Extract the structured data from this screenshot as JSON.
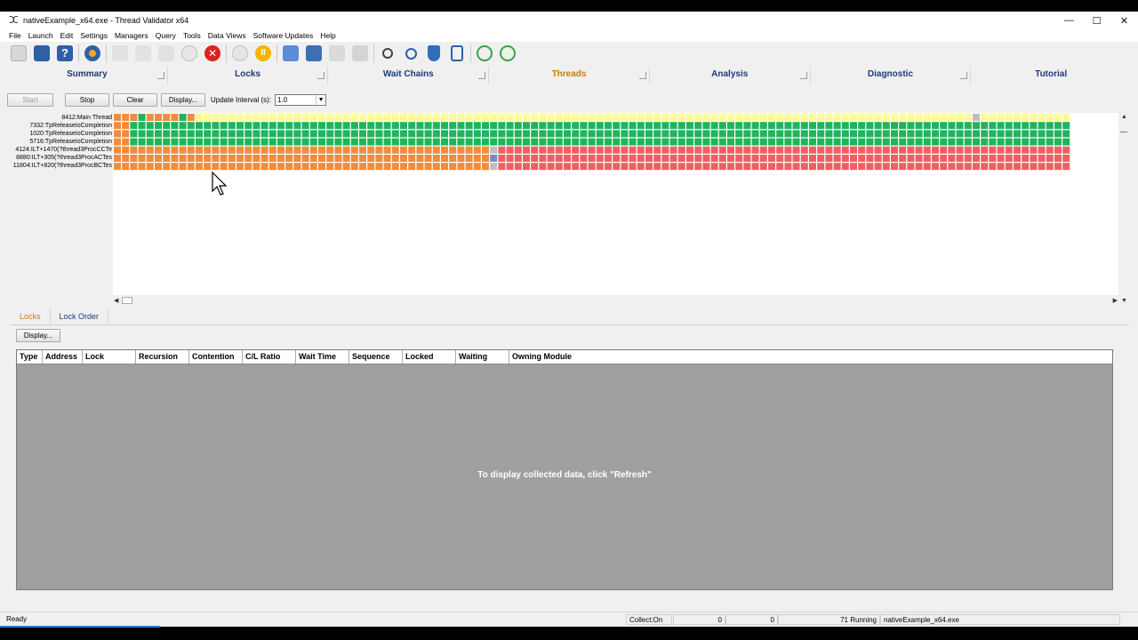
{
  "window": {
    "title": "nativeExample_x64.exe - Thread Validator x64",
    "controls": [
      "—",
      "☐",
      "✕"
    ]
  },
  "menu": [
    "File",
    "Launch",
    "Edit",
    "Settings",
    "Managers",
    "Query",
    "Tools",
    "Data Views",
    "Software Updates",
    "Help"
  ],
  "toolbar": {
    "icons": [
      "open-icon",
      "save-icon",
      "help-icon",
      "settings-gear-icon",
      "launch-icon",
      "inject-icon",
      "monitor-icon",
      "timer-icon",
      "stop-icon",
      "play-icon",
      "pause-icon",
      "add-folder-icon",
      "bookmark-icon",
      "group-icon",
      "factory-icon",
      "find-icon",
      "find-object-icon",
      "shield-icon",
      "book-icon",
      "refresh-icon",
      "auto-refresh-icon"
    ]
  },
  "tabs": [
    {
      "label": "Summary",
      "active": false
    },
    {
      "label": "Locks",
      "active": false
    },
    {
      "label": "Wait Chains",
      "active": false
    },
    {
      "label": "Threads",
      "active": true
    },
    {
      "label": "Analysis",
      "active": false
    },
    {
      "label": "Diagnostic",
      "active": false
    },
    {
      "label": "Tutorial",
      "active": false
    }
  ],
  "controls": {
    "start": "Start",
    "stop": "Stop",
    "clear": "Clear",
    "display": "Display...",
    "interval_label": "Update Interval (s):",
    "interval_value": "1.0"
  },
  "threads": [
    {
      "name": "8412:Main Thread",
      "pattern": "main"
    },
    {
      "name": "7332:TpReleaseIoCompletion",
      "pattern": "green"
    },
    {
      "name": "1020:TpReleaseIoCompletion",
      "pattern": "green"
    },
    {
      "name": "5716:TpReleaseIoCompletion",
      "pattern": "green"
    },
    {
      "name": "4124:ILT+1470(?thread3ProcCCTe",
      "pattern": "orange-red"
    },
    {
      "name": "8880:ILT+305(?thread3ProcACTes",
      "pattern": "orange-red"
    },
    {
      "name": "11804:ILT+820(?thread3ProcBCTes",
      "pattern": "orange-red"
    }
  ],
  "colors": {
    "orange": "#f08c3c",
    "green": "#1fb55a",
    "red": "#ef5f63",
    "yellow": "#fbfb8e",
    "blue": "#7c88c4",
    "grey": "#bdbdbd",
    "accent": "#c77c0a",
    "tab_text": "#1f3a78"
  },
  "lower_tabs": [
    {
      "label": "Locks",
      "active": true
    },
    {
      "label": "Lock Order",
      "active": false
    }
  ],
  "lower_display": "Display...",
  "table": {
    "columns": [
      "Type",
      "Address",
      "Lock",
      "Recursion",
      "Contention",
      "C/L Ratio",
      "Wait Time",
      "Sequence",
      "Locked",
      "Waiting",
      "Owning Module"
    ],
    "empty_message": "To display collected data, click \"Refresh\""
  },
  "status": {
    "ready": "Ready",
    "collect": "Collect:On",
    "val1": "0",
    "val2": "0",
    "running": "71 Running",
    "exe": "nativeExample_x64.exe"
  }
}
